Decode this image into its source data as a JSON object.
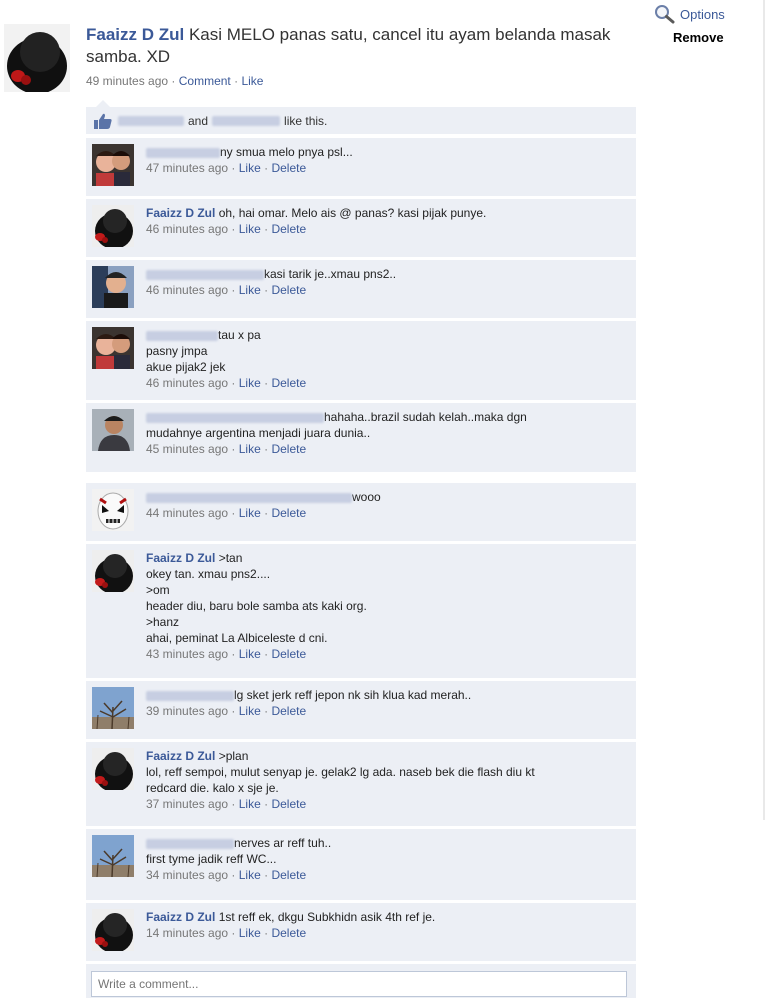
{
  "header": {
    "options_label": "Options",
    "remove_label": "Remove"
  },
  "post": {
    "author": "Faaizz D Zul",
    "text": "Kasi MELO panas satu, cancel itu ayam belanda masak samba. XD",
    "time": "49 minutes ago",
    "comment_label": "Comment",
    "like_label": "Like",
    "sep": "·"
  },
  "likes": {
    "and": "and",
    "suffix": "like this."
  },
  "comment_actions": {
    "like": "Like",
    "delete": "Delete"
  },
  "comments": [
    {
      "author": "",
      "text": "ny smua melo pnya psl...",
      "time": "47 minutes ago"
    },
    {
      "author": "Faaizz D Zul",
      "text": "oh, hai omar. Melo ais @ panas? kasi pijak punye.",
      "time": "46 minutes ago"
    },
    {
      "author": "",
      "text": "kasi tarik je..xmau pns2..",
      "time": "46 minutes ago"
    },
    {
      "author": "",
      "text": "tau x pa\npasny jmpa\nakue pijak2 jek",
      "time": "46 minutes ago"
    },
    {
      "author": "",
      "text": "hahaha..brazil sudah kelah..maka dgn\nmudahnye argentina menjadi juara dunia..",
      "time": "45 minutes ago"
    },
    {
      "author": "",
      "text": "wooo",
      "time": "44 minutes ago"
    },
    {
      "author": "Faaizz D Zul",
      "text": ">tan\nokey tan. xmau pns2....\n>om\nheader diu, baru bole samba ats kaki org.\n>hanz\nahai, peminat La Albiceleste d cni.",
      "time": "43 minutes ago"
    },
    {
      "author": "",
      "text": "lg sket jerk reff jepon nk sih klua kad merah..",
      "time": "39 minutes ago"
    },
    {
      "author": "Faaizz D Zul",
      "text": ">plan\nlol, reff sempoi, mulut senyap je. gelak2 lg ada. naseb bek die flash diu kt\nredcard die. kalo x sje je.",
      "time": "37 minutes ago"
    },
    {
      "author": "",
      "text": "nerves ar reff tuh..\nfirst tyme jadik reff WC...",
      "time": "34 minutes ago"
    },
    {
      "author": "Faaizz D Zul",
      "text": "1st reff ek, dkgu Subkhidn asik 4th ref je.",
      "time": "14 minutes ago"
    }
  ],
  "composer": {
    "placeholder": "Write a comment..."
  },
  "colors": {
    "link": "#3b5998",
    "comment_bg": "#eceff5",
    "border": "#bdc7d8"
  }
}
